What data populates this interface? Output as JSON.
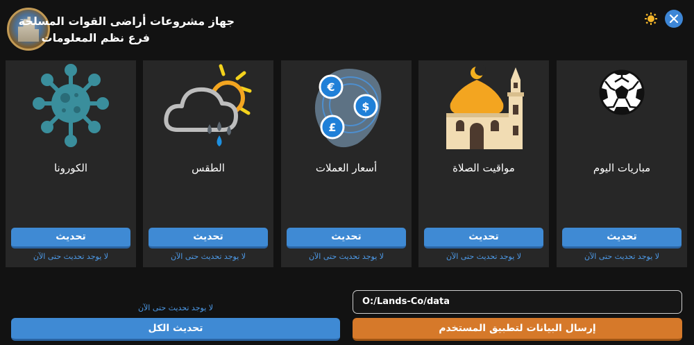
{
  "header": {
    "title_line1": "جهاز مشروعات أراضى القوات المسلحة",
    "title_line2": "فرع نظم المعلومات"
  },
  "cards": [
    {
      "icon": "coronavirus-icon",
      "label": "الكورونا",
      "button": "تحديث",
      "status": "لا يوجد تحديث حتى الآن"
    },
    {
      "icon": "weather-icon",
      "label": "الطقس",
      "button": "تحديث",
      "status": "لا يوجد تحديث حتى الآن"
    },
    {
      "icon": "currency-icon",
      "label": "أسعار العملات",
      "button": "تحديث",
      "status": "لا يوجد تحديث حتى الآن"
    },
    {
      "icon": "mosque-icon",
      "label": "مواقيت الصلاة",
      "button": "تحديث",
      "status": "لا يوجد تحديث حتى الآن"
    },
    {
      "icon": "football-icon",
      "label": "مباريات اليوم",
      "button": "تحديث",
      "status": "لا يوجد تحديث حتى الآن"
    }
  ],
  "footer": {
    "path_value": "O:/Lands-Co/data",
    "send_button": "إرسال البيانات لتطبيق المستخدم",
    "update_all_status": "لا يوجد تحديث حتى الآن",
    "update_all_button": "تحديث الكل"
  },
  "colors": {
    "background": "#121212",
    "card": "#272727",
    "primary": "#3f8ad4",
    "accent": "#d6792a",
    "status_text": "#4d9ae8"
  }
}
